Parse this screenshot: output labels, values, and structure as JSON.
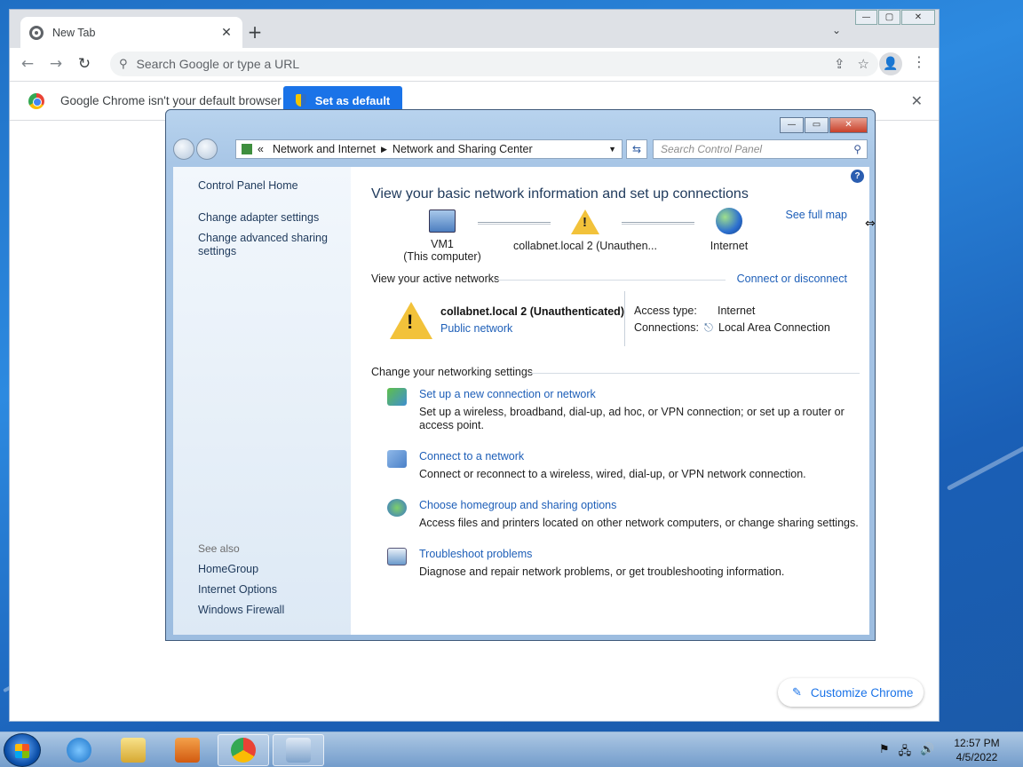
{
  "chrome": {
    "tab_title": "New Tab",
    "tab_close": "✕",
    "new_tab": "+",
    "tab_search": "⌄",
    "win_min": "—",
    "win_max": "▢",
    "win_close": "✕",
    "nav_back": "←",
    "nav_forward": "→",
    "nav_reload": "↻",
    "omnibox_placeholder": "Search Google or type a URL",
    "share_icon": "⇪",
    "star_icon": "☆",
    "profile_icon": "👤",
    "menu_icon": "⋮",
    "infobar_message": "Google Chrome isn't your default browser",
    "set_default_label": "Set as default",
    "infobar_close": "✕",
    "customize_label": "Customize Chrome",
    "customize_icon": "✎"
  },
  "control_panel": {
    "window_min": "—",
    "window_max": "▭",
    "window_close": "✕",
    "breadcrumb": {
      "prefix": "«",
      "items": [
        "Network and Internet",
        "Network and Sharing Center"
      ]
    },
    "search_placeholder": "Search Control Panel",
    "search_icon": "⚲",
    "refresh_icon": "⇆",
    "help_icon": "?",
    "sidebar": {
      "home": "Control Panel Home",
      "links": [
        "Change adapter settings",
        "Change advanced sharing settings"
      ],
      "see_also_label": "See also",
      "see_also": [
        "HomeGroup",
        "Internet Options",
        "Windows Firewall"
      ]
    },
    "heading": "View your basic network information and set up connections",
    "see_full_map": "See full map",
    "map": {
      "computer_name": "VM1",
      "computer_sub": "(This computer)",
      "network": "collabnet.local  2 (Unauthen...",
      "internet": "Internet"
    },
    "active_networks_label": "View your active networks",
    "connect_disconnect": "Connect or disconnect",
    "active": {
      "name": "collabnet.local  2 (Unauthenticated)",
      "type": "Public network",
      "access_type_label": "Access type:",
      "access_type_value": "Internet",
      "connections_label": "Connections:",
      "connections_value": "Local Area Connection"
    },
    "settings_label": "Change your networking settings",
    "tasks": [
      {
        "title": "Set up a new connection or network",
        "desc": "Set up a wireless, broadband, dial-up, ad hoc, or VPN connection; or set up a router or access point.",
        "icon": "new-connection-icon",
        "color": "#3f8fd0"
      },
      {
        "title": "Connect to a network",
        "desc": "Connect or reconnect to a wireless, wired, dial-up, or VPN network connection.",
        "icon": "connect-network-icon",
        "color": "#4a80c8"
      },
      {
        "title": "Choose homegroup and sharing options",
        "desc": "Access files and printers located on other network computers, or change sharing settings.",
        "icon": "homegroup-icon",
        "color": "#5aa04a"
      },
      {
        "title": "Troubleshoot problems",
        "desc": "Diagnose and repair network problems, or get troubleshooting information.",
        "icon": "troubleshoot-icon",
        "color": "#6a9acb"
      }
    ]
  },
  "taskbar": {
    "time": "12:57 PM",
    "date": "4/5/2022",
    "tray_icons": [
      "⚑",
      "🖧",
      "🔊"
    ]
  }
}
